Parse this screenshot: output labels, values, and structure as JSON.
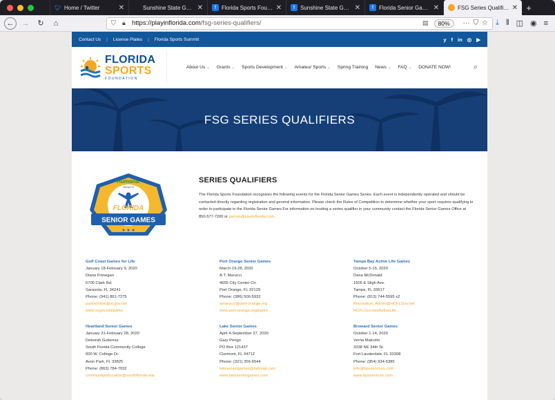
{
  "browser": {
    "tabs": [
      {
        "title": "Home / Twitter",
        "icon": "twitter-icon",
        "color": "#1da1f2"
      },
      {
        "title": "Sunshine State Games | Oly",
        "icon": "page-icon",
        "color": ""
      },
      {
        "title": "Florida Sports Foundatio",
        "icon": "facebook-icon",
        "color": "#1877f2"
      },
      {
        "title": "Sunshine State Games -",
        "icon": "facebook-icon",
        "color": "#1877f2"
      },
      {
        "title": "Florida Senior Games -",
        "icon": "facebook-icon",
        "color": "#1877f2"
      },
      {
        "title": "FSG Series Qualifiers – F",
        "icon": "fsf-icon",
        "color": "#f5a623",
        "active": true
      }
    ],
    "new_tab_label": "+",
    "url_host": "https://playinflorida.com",
    "url_path": "/fsg-series-qualifiers/",
    "zoom": "80%",
    "more": "···"
  },
  "site": {
    "topbar_links": [
      "Contact Us",
      "License Plates",
      "Florida Sports Summit"
    ],
    "social_icons": [
      "y",
      "f",
      "in",
      "◎",
      "▶"
    ],
    "logo": {
      "line1": "FLORIDA",
      "line2": "SPORTS",
      "line3": "FOUNDATION"
    },
    "nav": [
      {
        "label": "About Us",
        "dropdown": true
      },
      {
        "label": "Grants",
        "dropdown": true
      },
      {
        "label": "Sports Development",
        "dropdown": true
      },
      {
        "label": "Amateur Sports",
        "dropdown": true
      },
      {
        "label": "Spring Training",
        "dropdown": false
      },
      {
        "label": "News",
        "dropdown": true
      },
      {
        "label": "FAQ",
        "dropdown": true
      },
      {
        "label": "DONATE NOW!",
        "dropdown": false
      }
    ],
    "hero_title": "FSG SERIES QUALIFIERS",
    "badge": {
      "top": "Humana.",
      "presents": "PRESENTS",
      "word1": "FLORIDA",
      "word2": "SENIOR GAMES"
    },
    "section_title": "SERIES QUALIFIERS",
    "intro_text": "The Florida Sports Foundation recognizes the following events for the Florida Senior Games Series. Each event is independently operated and should be contacted directly regarding registration and general information. Please check the Rules of Competition to determine whether your sport requires qualifying in order to participate in the Florida Senior Games.For information on hosting a series qualifier in your community contact the Florida Senior Games Office at 850-577-7200 or",
    "intro_email": "games@playinflorida.com",
    "intro_end": ".",
    "events": [
      {
        "name": "Gulf Coast Games for Life",
        "dates": "January 18-February 9, 2020",
        "contact": "Diana Finnegan",
        "addr1": "6700 Clark Rd.",
        "addr2": "Sarasota, FL 34241",
        "phone": "Phone: (941) 861-7275",
        "email": "parksonline@scgov.net",
        "web": "www.scgov.net/parks"
      },
      {
        "name": "Port Orange Senior Games",
        "dates": "March 19-28, 2020",
        "contact": "A.T. Marucci",
        "addr1": "4655 City Center Cir.",
        "addr2": "Port Orange, FL 32129",
        "phone": "Phone: (386) 506-5932",
        "email": "amarucci@port-orange.org",
        "web": "www.port-orange.org/parks"
      },
      {
        "name": "Tampa Bay Active Life Games",
        "dates": "October 5-15, 2020",
        "contact": "Dana McDonald",
        "addr1": "1605 E Sligh Ave.",
        "addr2": "Tampa, FL 33617",
        "phone": "Phone: (813) 744-5595 x2",
        "email": "Recreation_Admin@HCFLGov.net",
        "web": "HCFLGov.net/ActiveLife"
      },
      {
        "name": "Heartland Senior Games",
        "dates": "January 31-February 28, 2020",
        "contact": "Deborah Gutierrez",
        "addr1": "South Florida Community College",
        "addr2": "600 W. College Dr.",
        "addr3": "Avon Park, FL 33825",
        "phone": "Phone: (863) 784-7032",
        "email": "communityeducation@southflorida.edu",
        "web": ""
      },
      {
        "name": "Lake Senior Games",
        "dates": "April 4-September 27, 2020",
        "contact": "Gary Perigo",
        "addr1": "PO Box 121437",
        "addr2": "Clermont, FL 34712",
        "phone": "Phone: (321) 356-6544",
        "email": "lakeseniorgames@hotmail.com",
        "web": "www.lakeseniorgames.com"
      },
      {
        "name": "Broward Senior Games",
        "dates": "October 1-14, 2020",
        "contact": "Verna Malcolm",
        "addr1": "3338 NE 34th St.",
        "addr2": "Fort Lauderdale, FL 33308",
        "phone": "Phone: (954) 934-5385",
        "email": "info@bpsservices.com",
        "web": "www.bpsservices.com"
      }
    ]
  }
}
